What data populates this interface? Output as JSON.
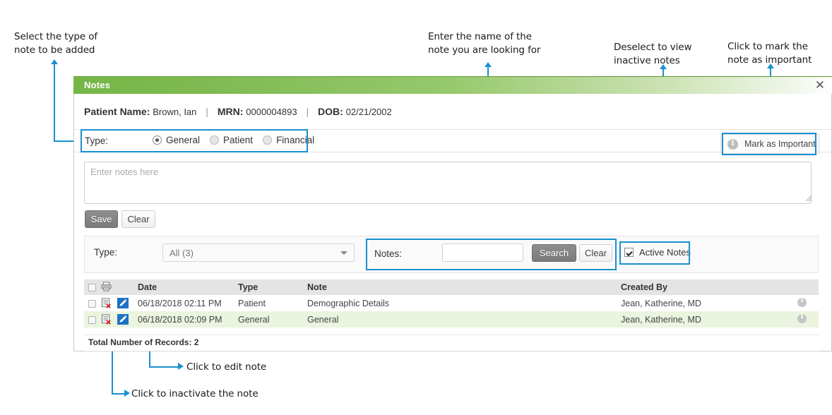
{
  "annotations": [
    {
      "id": "a1",
      "text": "Select the type of\nnote to be added"
    },
    {
      "id": "a2",
      "text": "Enter the name of the\nnote you are looking for"
    },
    {
      "id": "a3",
      "text": "Deselect to view\ninactive notes"
    },
    {
      "id": "a4",
      "text": "Click to mark the\nnote as important"
    },
    {
      "id": "a5",
      "text": "Click to edit note"
    },
    {
      "id": "a6",
      "text": "Click to inactivate the note"
    }
  ],
  "panel": {
    "title": "Notes",
    "close_label": "✕",
    "accent_green": "#76b646",
    "highlight_blue": "#1a8fd1"
  },
  "patient": {
    "name_label": "Patient Name:",
    "name_value": "Brown, Ian",
    "sep": "|",
    "mrn_label": "MRN:",
    "mrn_value": "0000004893",
    "dob_label": "DOB:",
    "dob_value": "02/21/2002"
  },
  "type_row": {
    "label": "Type:",
    "options": [
      {
        "label": "General",
        "selected": true
      },
      {
        "label": "Patient",
        "selected": false
      },
      {
        "label": "Financial",
        "selected": false
      }
    ],
    "mark_important": "Mark as Important"
  },
  "editor": {
    "placeholder": "Enter notes here",
    "value": "",
    "save_label": "Save",
    "clear_label": "Clear"
  },
  "filter": {
    "type_label": "Type:",
    "type_selected": "All (3)",
    "notes_label": "Notes:",
    "notes_value": "",
    "search_label": "Search",
    "clear_label": "Clear",
    "active_notes_label": "Active Notes",
    "active_notes_checked": true
  },
  "table": {
    "columns": [
      "",
      "",
      "Date",
      "Type",
      "Note",
      "Created By",
      ""
    ],
    "headers": {
      "date": "Date",
      "type": "Type",
      "note": "Note",
      "created_by": "Created By"
    },
    "rows": [
      {
        "date": "06/18/2018 02:11 PM",
        "type": "Patient",
        "note": "Demographic Details",
        "created_by": "Jean, Katherine, MD"
      },
      {
        "date": "06/18/2018 02:09 PM",
        "type": "General",
        "note": "General",
        "created_by": "Jean, Katherine, MD"
      }
    ],
    "total_label": "Total Number of Records: 2"
  }
}
